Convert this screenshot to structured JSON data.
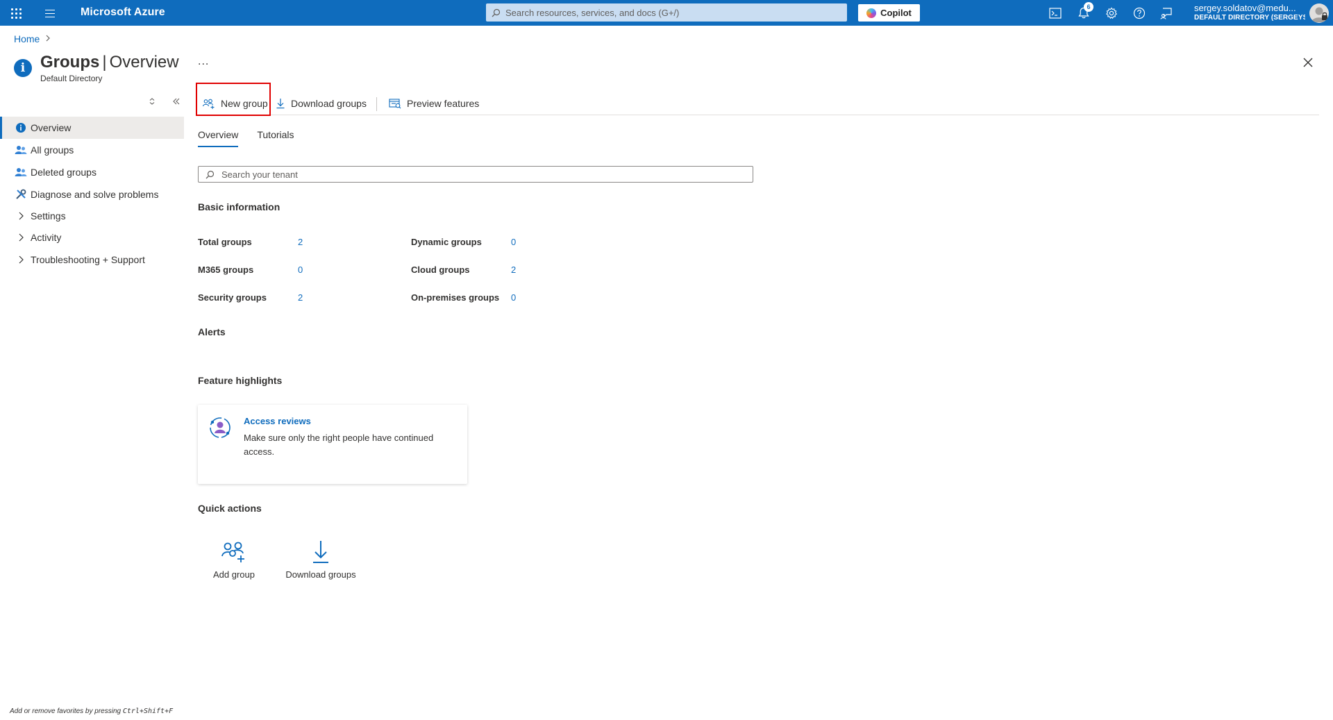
{
  "topbar": {
    "brand": "Microsoft Azure",
    "search_placeholder": "Search resources, services, and docs (G+/)",
    "copilot_label": "Copilot",
    "notification_count": "6",
    "account_name": "sergey.soldatov@medu...",
    "account_directory": "DEFAULT DIRECTORY (SERGEYSO..."
  },
  "breadcrumb": {
    "home": "Home"
  },
  "header": {
    "title_bold": "Groups",
    "title_sep": "|",
    "title_rest": "Overview",
    "subtitle": "Default Directory",
    "more": "..."
  },
  "sidebar": {
    "items": [
      {
        "label": "Overview",
        "icon": "info-icon"
      },
      {
        "label": "All groups",
        "icon": "groups-icon"
      },
      {
        "label": "Deleted groups",
        "icon": "groups-icon"
      },
      {
        "label": "Diagnose and solve problems",
        "icon": "wrench-icon"
      },
      {
        "label": "Settings",
        "icon": "chevron-right-icon"
      },
      {
        "label": "Activity",
        "icon": "chevron-right-icon"
      },
      {
        "label": "Troubleshooting + Support",
        "icon": "chevron-right-icon"
      }
    ]
  },
  "toolbar": {
    "new_group": "New group",
    "download_groups": "Download groups",
    "preview_features": "Preview features"
  },
  "tabs": [
    "Overview",
    "Tutorials"
  ],
  "tenant_search": {
    "placeholder": "Search your tenant"
  },
  "basic_info": {
    "heading": "Basic information",
    "left": [
      {
        "label": "Total groups",
        "value": "2"
      },
      {
        "label": "M365 groups",
        "value": "0"
      },
      {
        "label": "Security groups",
        "value": "2"
      }
    ],
    "right": [
      {
        "label": "Dynamic groups",
        "value": "0"
      },
      {
        "label": "Cloud groups",
        "value": "2"
      },
      {
        "label": "On-premises groups",
        "value": "0"
      }
    ]
  },
  "alerts": {
    "heading": "Alerts"
  },
  "feature_highlights": {
    "heading": "Feature highlights",
    "card_title": "Access reviews",
    "card_desc": "Make sure only the right people have continued access."
  },
  "quick_actions": {
    "heading": "Quick actions",
    "items": [
      {
        "label": "Add group",
        "icon": "add-group-icon"
      },
      {
        "label": "Download groups",
        "icon": "download-icon"
      }
    ]
  },
  "footer": {
    "hint_prefix": "Add or remove favorites by pressing",
    "hint_keys": "Ctrl+Shift+F"
  },
  "colors": {
    "brand_blue": "#0f6cbd",
    "highlight_red": "#e00000"
  }
}
